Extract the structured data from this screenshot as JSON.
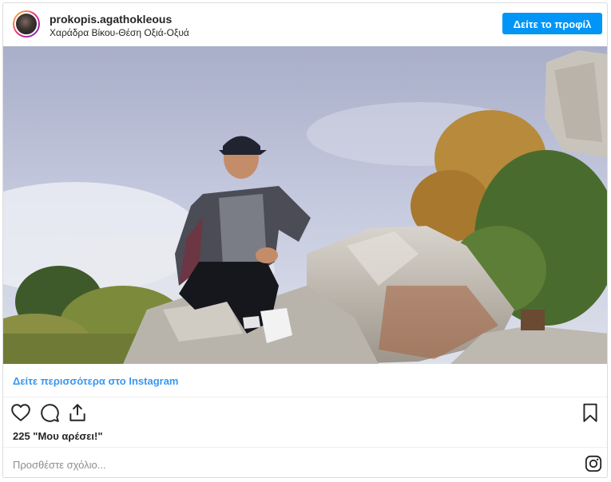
{
  "post": {
    "username": "prokopis.agathokleous",
    "location": "Χαράδρα Βίκου-Θέση Οξιά-Οξυά",
    "profile_button": "Δείτε το προφίλ",
    "see_more": "Δείτε περισσότερα στο Instagram",
    "likes": "225 \"Μου αρέσει!\"",
    "comment_placeholder": "Προσθέστε σχόλιο...",
    "photo_alt": ""
  },
  "icons": {
    "like": "heart-icon",
    "comment": "comment-icon",
    "share": "share-icon",
    "save": "bookmark-icon",
    "brand": "instagram-icon"
  },
  "colors": {
    "accent": "#0095f6",
    "link": "#3897f0",
    "text": "#262626",
    "muted": "#8e8e8e"
  }
}
